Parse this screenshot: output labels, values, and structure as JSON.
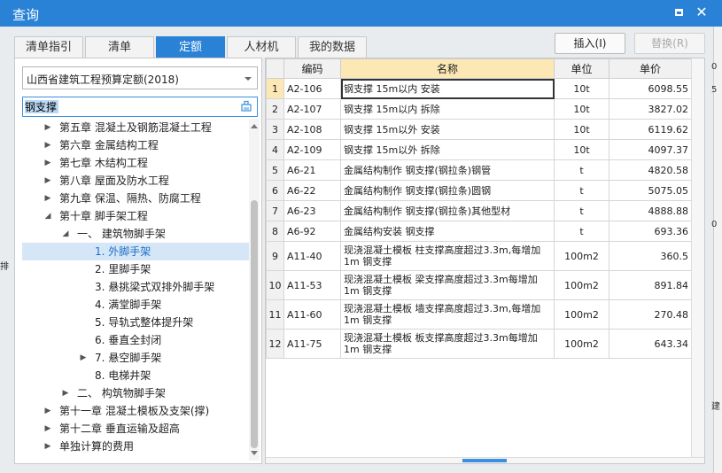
{
  "window": {
    "title": "查询",
    "max_icon": "maximize-icon",
    "close_icon": "close-icon",
    "close_glyph": "✕"
  },
  "tabs": [
    {
      "label": "清单指引",
      "active": false
    },
    {
      "label": "清单",
      "active": false
    },
    {
      "label": "定额",
      "active": true
    },
    {
      "label": "人材机",
      "active": false
    },
    {
      "label": "我的数据",
      "active": false
    }
  ],
  "buttons": {
    "insert": "插入(I)",
    "replace": "替换(R)"
  },
  "left": {
    "dropdown_value": "山西省建筑工程预算定额(2018)",
    "search_value": "钢支撑",
    "tree": [
      {
        "label": "第五章 混凝土及钢筋混凝土工程",
        "arrow": "▶"
      },
      {
        "label": "第六章 金属结构工程",
        "arrow": "▶"
      },
      {
        "label": "第七章 木结构工程",
        "arrow": "▶"
      },
      {
        "label": "第八章 屋面及防水工程",
        "arrow": "▶"
      },
      {
        "label": "第九章 保温、隔热、防腐工程",
        "arrow": "▶"
      },
      {
        "label": "第十章 脚手架工程",
        "arrow": "◢"
      },
      {
        "label": "一、 建筑物脚手架",
        "arrow": "◢"
      },
      {
        "label": "1. 外脚手架",
        "arrow": "",
        "selected": true
      },
      {
        "label": "2. 里脚手架",
        "arrow": ""
      },
      {
        "label": "3. 悬挑梁式双排外脚手架",
        "arrow": ""
      },
      {
        "label": "4. 满堂脚手架",
        "arrow": ""
      },
      {
        "label": "5. 导轨式整体提升架",
        "arrow": ""
      },
      {
        "label": "6. 垂直全封闭",
        "arrow": ""
      },
      {
        "label": "7. 悬空脚手架",
        "arrow": "▶"
      },
      {
        "label": "8. 电梯井架",
        "arrow": ""
      },
      {
        "label": "二、 构筑物脚手架",
        "arrow": "▶"
      },
      {
        "label": "第十一章 混凝土模板及支架(撑)",
        "arrow": "▶"
      },
      {
        "label": "第十二章 垂直运输及超高",
        "arrow": "▶"
      },
      {
        "label": "单独计算的费用",
        "arrow": "▶"
      }
    ]
  },
  "grid": {
    "columns": [
      "",
      "编码",
      "名称",
      "单位",
      "单价"
    ],
    "rows": [
      {
        "idx": "1",
        "code": "A2-106",
        "name": "钢支撑 15m以内 安装",
        "unit": "10t",
        "price": "6098.55"
      },
      {
        "idx": "2",
        "code": "A2-107",
        "name": "钢支撑 15m以内 拆除",
        "unit": "10t",
        "price": "3827.02"
      },
      {
        "idx": "3",
        "code": "A2-108",
        "name": "钢支撑 15m以外 安装",
        "unit": "10t",
        "price": "6119.62"
      },
      {
        "idx": "4",
        "code": "A2-109",
        "name": "钢支撑 15m以外 拆除",
        "unit": "10t",
        "price": "4097.37"
      },
      {
        "idx": "5",
        "code": "A6-21",
        "name": "金属结构制作 钢支撑(钢拉条)钢管",
        "unit": "t",
        "price": "4820.58"
      },
      {
        "idx": "6",
        "code": "A6-22",
        "name": "金属结构制作 钢支撑(钢拉条)圆钢",
        "unit": "t",
        "price": "5075.05"
      },
      {
        "idx": "7",
        "code": "A6-23",
        "name": "金属结构制作 钢支撑(钢拉条)其他型材",
        "unit": "t",
        "price": "4888.88"
      },
      {
        "idx": "8",
        "code": "A6-92",
        "name": "金属结构安装 钢支撑",
        "unit": "t",
        "price": "693.36"
      },
      {
        "idx": "9",
        "code": "A11-40",
        "name": "现浇混凝土模板 柱支撑高度超过3.3m,每增加1m 钢支撑",
        "unit": "100m2",
        "price": "360.5"
      },
      {
        "idx": "10",
        "code": "A11-53",
        "name": "现浇混凝土模板 梁支撑高度超过3.3m每增加1m 钢支撑",
        "unit": "100m2",
        "price": "891.84"
      },
      {
        "idx": "11",
        "code": "A11-60",
        "name": "现浇混凝土模板 墙支撑高度超过3.3m,每增加1m 钢支撑",
        "unit": "100m2",
        "price": "270.48"
      },
      {
        "idx": "12",
        "code": "A11-75",
        "name": "现浇混凝土模板 板支撑高度超过3.3m每增加1m 钢支撑",
        "unit": "100m2",
        "price": "643.34"
      }
    ]
  },
  "background_fragments": [
    "0",
    "5",
    "0",
    "建",
    "排"
  ],
  "colors": {
    "titlebar": "#2a82d6",
    "active_tab": "#2a82d6",
    "name_header": "#fbe8b4",
    "selected_tree": "#d5e6f7"
  }
}
